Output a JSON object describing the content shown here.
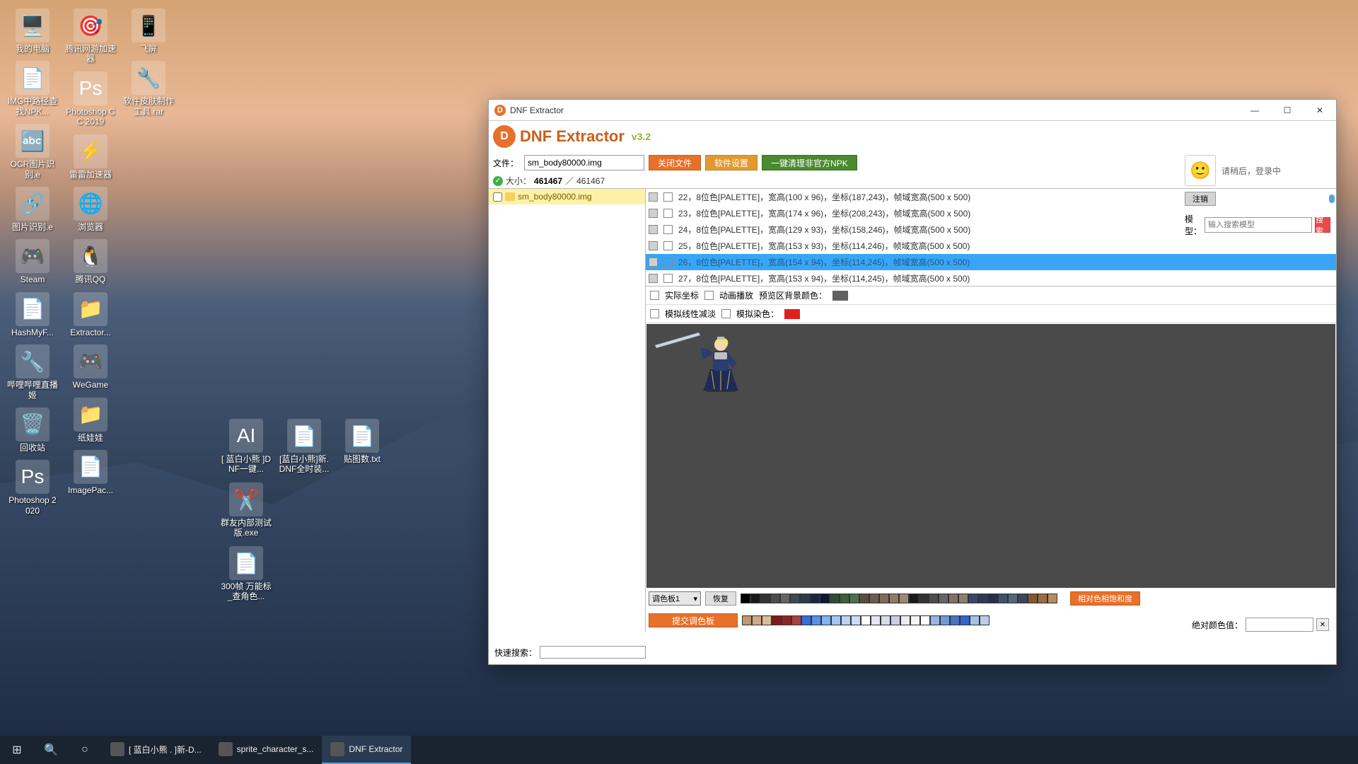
{
  "desktop_icons": [
    {
      "icon": "🖥️",
      "label": "我的电脑"
    },
    {
      "icon": "📄",
      "label": "IMG中路径查找NPK..."
    },
    {
      "icon": "🔤",
      "label": "OCR图片识别.e"
    },
    {
      "icon": "🔗",
      "label": "图片识别.e"
    },
    {
      "icon": "🎮",
      "label": "Steam"
    },
    {
      "icon": "📄",
      "label": "HashMyF..."
    },
    {
      "icon": "🔧",
      "label": "哔哩哔哩直播姬"
    },
    {
      "icon": "🗑️",
      "label": "回收站"
    },
    {
      "icon": "Ps",
      "label": "Photoshop 2020"
    },
    {
      "icon": "🎯",
      "label": "腾讯网游加速器"
    },
    {
      "icon": "Ps",
      "label": "Photoshop CC 2019"
    },
    {
      "icon": "⚡",
      "label": "雷雷加速器"
    },
    {
      "icon": "🌐",
      "label": "浏览器"
    },
    {
      "icon": "🐧",
      "label": "腾讯QQ"
    },
    {
      "icon": "📁",
      "label": "Extractor..."
    },
    {
      "icon": "🎮",
      "label": "WeGame"
    },
    {
      "icon": "📁",
      "label": "纸娃娃"
    },
    {
      "icon": "📄",
      "label": "ImagePac..."
    },
    {
      "icon": "📱",
      "label": "飞屏"
    },
    {
      "icon": "🔧",
      "label": "软件皮肤制作工具.rar"
    }
  ],
  "desktop_extra": [
    {
      "icon": "AI",
      "label": "[ 蓝白小熊 ]DNF一键..."
    },
    {
      "icon": "📄",
      "label": "[蓝白小熊]新.DNF全时装..."
    },
    {
      "icon": "📄",
      "label": "贴图数.txt"
    }
  ],
  "desktop_row2": {
    "icon": "✂️",
    "label": "群友内部测试版.exe"
  },
  "desktop_row3": {
    "icon": "📄",
    "label": "300帧 万能标_查角色..."
  },
  "taskbar": {
    "items": [
      {
        "label": "[ 蓝白小熊 . ]新-D..."
      },
      {
        "label": "sprite_character_s..."
      },
      {
        "label": "DNF Extractor"
      }
    ]
  },
  "window": {
    "title": "DNF Extractor",
    "logo": "DNF Extractor",
    "version": "v3.2",
    "file_label": "文件：",
    "file_value": "sm_body80000.img",
    "btn_close_file": "关闭文件",
    "btn_settings": "软件设置",
    "btn_clean": "一键清理非官方NPK",
    "size_label": "大小：",
    "size_a": "461467",
    "size_b": "461467",
    "tree_item": "sm_body80000.img",
    "list": [
      {
        "idx": "22",
        "text": "8位色[PALETTE]，宽高(100 x 96)，坐标(187,243)，帧域宽高(500 x 500)"
      },
      {
        "idx": "23",
        "text": "8位色[PALETTE]，宽高(174 x 96)，坐标(208,243)，帧域宽高(500 x 500)"
      },
      {
        "idx": "24",
        "text": "8位色[PALETTE]，宽高(129 x 93)，坐标(158,246)，帧域宽高(500 x 500)"
      },
      {
        "idx": "25",
        "text": "8位色[PALETTE]，宽高(153 x 93)，坐标(114,246)，帧域宽高(500 x 500)"
      },
      {
        "idx": "26",
        "text": "8位色[PALETTE]，宽高(154 x 94)，坐标(114,245)，帧域宽高(500 x 500)"
      },
      {
        "idx": "27",
        "text": "8位色[PALETTE]，宽高(153 x 94)，坐标(114,245)，帧域宽高(500 x 500)"
      }
    ],
    "selected_idx": "26",
    "opt_real_coord": "实际坐标",
    "opt_anim_play": "动画播放",
    "opt_bg_label": "预览区背景颜色：",
    "opt_linear": "模拟线性减淡",
    "opt_tint": "模拟染色：",
    "palette_dd": "调色板1",
    "btn_restore": "恢复",
    "btn_hsl": "相对色相饱和度",
    "btn_submit_pal": "提交调色板",
    "abs_color_label": "绝对颜色值：",
    "quick_search": "快速搜索：",
    "side": {
      "login_text": "请稍后，登录中",
      "logout": "注销",
      "model": "模型：",
      "model_ph": "输入搜索模型",
      "search": "搜索"
    }
  },
  "palette": [
    "#000",
    "#1a1a1a",
    "#333",
    "#4d4d4d",
    "#666",
    "#404852",
    "#2d3b4d",
    "#1a2940",
    "#0d1933",
    "#304b33",
    "#3d5d3d",
    "#4d704d",
    "#5c4d40",
    "#705c4d",
    "#806b59",
    "#917a66",
    "#a18873",
    "#1a1a1a",
    "#333",
    "#4d4d4d",
    "#666",
    "#807366",
    "#8c7e70",
    "#3a4666",
    "#2e3a59",
    "#22304d",
    "#405266",
    "#526680",
    "#3d4859",
    "#805933",
    "#996b40",
    "#b38a66",
    "#bf9773",
    "#ccaa88",
    "#d9bb99",
    "#801a1a",
    "#8c2626",
    "#a84040",
    "#3370d9",
    "#5991e6",
    "#80b3f2",
    "#a1c7f2",
    "#b8d4f2",
    "#ccddf2",
    "#fff",
    "#e6e6f2",
    "#d9d9ec",
    "#ccccE6",
    "#ebebf5",
    "#f2f2f7",
    "#fff",
    "#99b3e6",
    "#7099d9",
    "#4773bf",
    "#3366cc",
    "#a6bde6",
    "#bfccE6"
  ]
}
